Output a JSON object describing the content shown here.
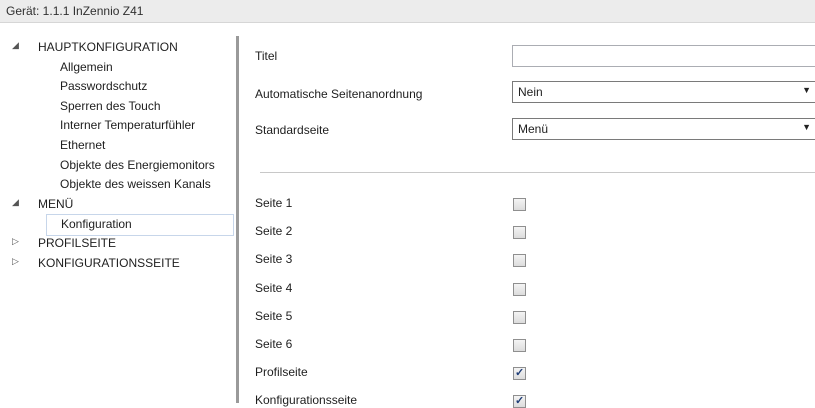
{
  "header": {
    "title": "Gerät: 1.1.1  InZennio Z41"
  },
  "tree": [
    {
      "label": "HAUPTKONFIGURATION",
      "expander": "◢",
      "level": 0,
      "selected": false
    },
    {
      "label": "Allgemein",
      "expander": "",
      "level": 1,
      "selected": false
    },
    {
      "label": "Passwordschutz",
      "expander": "",
      "level": 1,
      "selected": false
    },
    {
      "label": "Sperren des Touch",
      "expander": "",
      "level": 1,
      "selected": false
    },
    {
      "label": "Interner Temperaturfühler",
      "expander": "",
      "level": 1,
      "selected": false
    },
    {
      "label": "Ethernet",
      "expander": "",
      "level": 1,
      "selected": false
    },
    {
      "label": "Objekte des Energiemonitors",
      "expander": "",
      "level": 1,
      "selected": false
    },
    {
      "label": "Objekte des weissen Kanals",
      "expander": "",
      "level": 1,
      "selected": false
    },
    {
      "label": "MENÜ",
      "expander": "◢",
      "level": 0,
      "selected": false
    },
    {
      "label": "Konfiguration",
      "expander": "",
      "level": 1,
      "selected": true
    },
    {
      "label": "PROFILSEITE",
      "expander": "▷",
      "level": 0,
      "selected": false
    },
    {
      "label": "KONFIGURATIONSSEITE",
      "expander": "▷",
      "level": 0,
      "selected": false
    }
  ],
  "form": {
    "title_label": "Titel",
    "title_value": "",
    "auto_label": "Automatische Seitenanordnung",
    "auto_value": "Nein",
    "default_label": "Standardseite",
    "default_value": "Menü",
    "dropdown_arrow": "▼"
  },
  "pages": [
    {
      "label": "Seite 1",
      "checked": false
    },
    {
      "label": "Seite 2",
      "checked": false
    },
    {
      "label": "Seite 3",
      "checked": false
    },
    {
      "label": "Seite 4",
      "checked": false
    },
    {
      "label": "Seite 5",
      "checked": false
    },
    {
      "label": "Seite 6",
      "checked": false
    },
    {
      "label": "Profilseite",
      "checked": true
    },
    {
      "label": "Konfigurationsseite",
      "checked": true
    }
  ],
  "check_glyph": "✓"
}
